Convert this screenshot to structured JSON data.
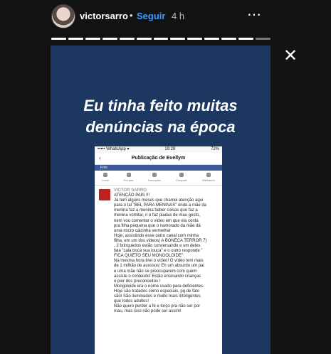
{
  "header": {
    "username": "victorsarro",
    "separator": "•",
    "follow_label": "Seguir",
    "time": "4 h",
    "more_icon": "⋯"
  },
  "story": {
    "segments_total": 13,
    "segments_viewed": 12,
    "close_icon": "✕",
    "headline": "Eu tinha feito muitas denúncias na época"
  },
  "screenshot": {
    "status_left": "••••• WhatsApp ▾",
    "status_time": "19:29",
    "status_right": "72%",
    "back_icon": "‹",
    "page_title": "Publicação de Evellym",
    "blue_bar": "Foto",
    "tabs": [
      {
        "label": "Início"
      },
      {
        "label": "Em alta"
      },
      {
        "label": "Inscrições"
      },
      {
        "label": "Compart."
      },
      {
        "label": "Biblioteca"
      }
    ],
    "post_author": "VICTOR SARRO",
    "post_lines": [
      "ATENÇÃO PAIS !!!",
      "Já tem alguns meses que chamei atenção aqui",
      "para o tal \"BEL PARA MENINAS\" onde a mãe da",
      "menina faz a menina beber coisas que faz a",
      "menina vomitar, ri e faz piadas de mau gosto,",
      "nem vou comentar o vídeo em que ela conta",
      "pra filha pequena que o namorado da mãe dá",
      "uma micro calcinha vermelha!",
      "Hoje, assistindo esse outro canal com minha",
      "filha, em um dos videos( A BONECA TERROR 7)",
      ", 2 brinquedos estão conversando e um deles",
      "fala \"cala boca sua louca\" e o outro responde \"",
      "FICA QUIETO SEU MONGOLOIDE\"",
      "Na mesma hora tirei o vídeo! O vídeo tem mais",
      "de 1 milhão de acessos! Eh um absurdo um pai",
      "e uma mãe não se preocuparem com quem",
      "assiste o conteúdo! Estão ensinando crianças",
      "o pior dos preconceitos !",
      "Mongoloide era o nome usado para deficientes.",
      "Hoje são tratados como especiais, pq de fato",
      "são! São iluminados e muito mais inteligentes",
      "que todos adultos!",
      "Não quero perder a fé e torço pra não ser por",
      "mau, mas isso não pode ser assim!"
    ]
  }
}
